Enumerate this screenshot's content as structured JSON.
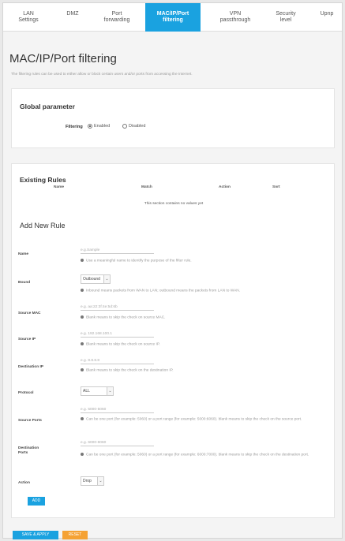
{
  "tabs": [
    {
      "label": "LAN\nSettings"
    },
    {
      "label": "DMZ"
    },
    {
      "label": "Port\nforwarding"
    },
    {
      "label": "MAC/IP/Port\nfiltering"
    },
    {
      "label": "VPN\npassthrough"
    },
    {
      "label": "Security\nlevel"
    },
    {
      "label": "Upnp"
    }
  ],
  "page": {
    "title": "MAC/IP/Port filtering",
    "intro": "The filtering rules can be used to either allow or block certain users and/or ports from accessing the Internet."
  },
  "global": {
    "title": "Global parameter",
    "filtering_label": "Filtering",
    "options": [
      "Enabled",
      "Disabled"
    ],
    "selected": "Enabled"
  },
  "rules": {
    "title": "Existing Rules",
    "columns": [
      "Name",
      "Match",
      "Action",
      "Sort"
    ],
    "empty_text": "This section contains no values yet"
  },
  "add_rule": {
    "title": "Add New Rule",
    "name": {
      "label": "Name",
      "placeholder": "e.g.Sample",
      "help": "Use a meaningful name to identify the purpose of the filter rule."
    },
    "bound": {
      "label": "Bound",
      "value": "Outbound",
      "help": "Inbound means packets from WAN to LAN; outbound means the packets from LAN to WAN."
    },
    "source_mac": {
      "label": "Source MAC",
      "placeholder": "e.g. aa:22:3f:4e:5d:6b",
      "help": "Blank means to skip the check on source MAC."
    },
    "source_ip": {
      "label": "Source IP",
      "placeholder": "e.g. 192.168.100.1",
      "help": "Blank means to skip the check on source IP."
    },
    "dest_ip": {
      "label": "Destination IP",
      "placeholder": "e.g. 8.8.8.8",
      "help": "Blank means to skip the check on the destination IP."
    },
    "protocol": {
      "label": "Protocol",
      "value": "ALL"
    },
    "source_ports": {
      "label": "Source Ports",
      "placeholder": "e.g. 5000-5060",
      "help": "Can be one port (for example: 5060) or a port range (for example: 5000:6060). blank means to skip the check on the source port."
    },
    "dest_ports": {
      "label": "Destination\nPorts",
      "placeholder": "e.g. 6000-6060",
      "help": "Can be one port (for example: 5060) or a port range (for example: 6000:7000). blank means to skip the check on the destination port."
    },
    "action": {
      "label": "Action",
      "value": "Drop"
    },
    "add_label": "ADD"
  },
  "footer": {
    "save_label": "SAVE & APPLY",
    "reset_label": "RESET"
  },
  "colors": {
    "accent": "#1aa2e0",
    "reset": "#f5a234"
  }
}
